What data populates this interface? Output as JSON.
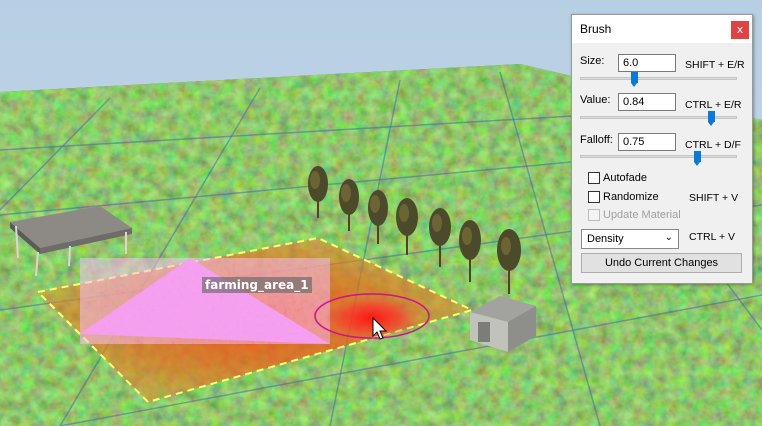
{
  "scene": {
    "object_label": "farming_area_1"
  },
  "brush": {
    "title": "Brush",
    "close_glyph": "x",
    "size": {
      "label": "Size:",
      "value": "6.0",
      "hotkey": "SHIFT + E/R",
      "fraction": 0.35
    },
    "value": {
      "label": "Value:",
      "value": "0.84",
      "hotkey": "CTRL + E/R",
      "fraction": 0.84
    },
    "falloff": {
      "label": "Falloff:",
      "value": "0.75",
      "hotkey": "CTRL + D/F",
      "fraction": 0.75
    },
    "autofade": {
      "label": "Autofade",
      "checked": false
    },
    "randomize": {
      "label": "Randomize",
      "checked": false,
      "hotkey": "SHIFT + V"
    },
    "update_material": {
      "label": "Update Material",
      "checked": false,
      "disabled": true
    },
    "mode": {
      "selected": "Density",
      "hotkey": "CTRL + V"
    },
    "undo_label": "Undo Current Changes"
  },
  "colors": {
    "accent": "#0a7ad8",
    "close": "#e04343",
    "selection_fill": "#f07ee8",
    "brush_hot": "#ff2a2a"
  }
}
